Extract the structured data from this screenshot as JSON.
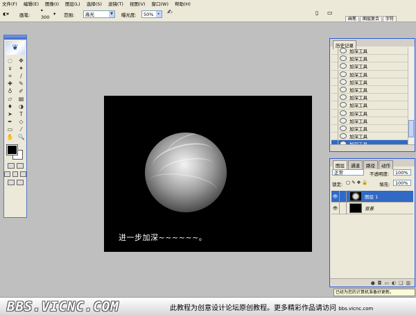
{
  "menu": [
    "文件(F)",
    "编辑(E)",
    "图像(I)",
    "图层(L)",
    "选择(S)",
    "滤镜(T)",
    "视图(V)",
    "窗口(W)",
    "帮助(H)"
  ],
  "options": {
    "brush_label": "画笔:",
    "brush_size": "300",
    "range_label": "范围:",
    "range_value": "高光",
    "exposure_label": "曝光度:",
    "exposure_value": "50%",
    "well_tabs": [
      "画笔",
      "图层复合",
      "字符"
    ]
  },
  "canvas": {
    "caption": "进一步加深~~~~~~。"
  },
  "history": {
    "tab": "历史记录",
    "items": [
      "加深工具",
      "加深工具",
      "加深工具",
      "加深工具",
      "加深工具",
      "加深工具",
      "加深工具",
      "加深工具",
      "加深工具",
      "加深工具",
      "加深工具",
      "加深工具",
      "加深工具"
    ],
    "selected_index": 12
  },
  "layers": {
    "tabs": [
      "图层",
      "通道",
      "路径",
      "动作"
    ],
    "blend_mode": "正常",
    "opacity_label": "不透明度:",
    "opacity_value": "100%",
    "lock_label": "锁定:",
    "fill_label": "填充:",
    "fill_value": "100%",
    "items": [
      {
        "name": "图层 1",
        "selected": true
      },
      {
        "name": "背景",
        "selected": false
      }
    ]
  },
  "status": "已经为您的计算机准备好更新。",
  "watermark": {
    "logo": "BBS.VICNC.COM",
    "text": "此教程为创意设计论坛原创教程。更多精彩作品请访问",
    "url": "bbs.vicnc.com"
  },
  "colors": {
    "panel_border": "#2a5bd7",
    "selection": "#316ac5",
    "canvas_bg": "#000000",
    "workspace": "#bfbfbf"
  }
}
